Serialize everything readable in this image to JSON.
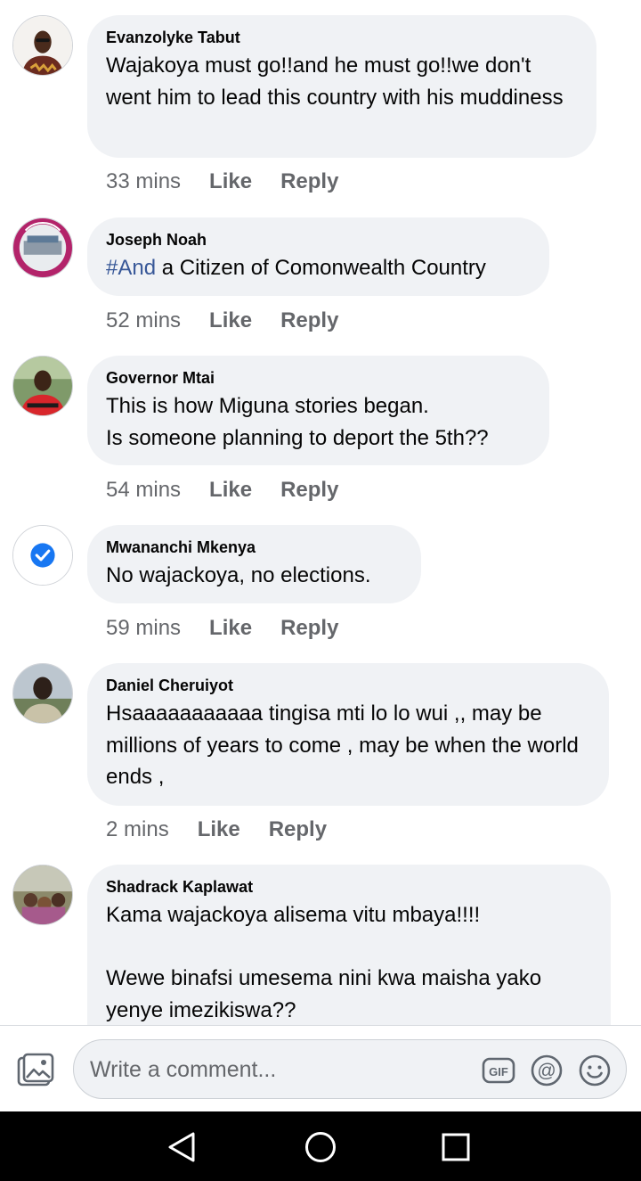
{
  "comments": [
    {
      "author": "Evanzolyke Tabut",
      "text": "Wajakoya must go!!and he must go!!we don't went him to lead this country with his muddiness",
      "time": "33 mins",
      "like": "Like",
      "reply": "Reply"
    },
    {
      "author": "Joseph Noah",
      "hashtag": "#And",
      "text": " a Citizen of Comonwealth Country",
      "time": "52 mins",
      "like": "Like",
      "reply": "Reply"
    },
    {
      "author": "Governor Mtai",
      "text": "This is how Miguna stories began.\nIs someone planning to deport the 5th??",
      "time": "54 mins",
      "like": "Like",
      "reply": "Reply"
    },
    {
      "author": "Mwananchi Mkenya",
      "text": "No wajackoya, no elections.",
      "time": "59 mins",
      "like": "Like",
      "reply": "Reply"
    },
    {
      "author": "Daniel Cheruiyot",
      "text": "Hsaaaaaaaaaaa tingisa mti lo lo wui ,, may be millions of years to come , may be when the world ends ,",
      "time": "2 mins",
      "like": "Like",
      "reply": "Reply"
    },
    {
      "author": "Shadrack Kaplawat",
      "text": "Kama wajackoya alisema vitu mbaya!!!!\n\nWewe binafsi umesema nini kwa maisha yako yenye imezikiswa??"
    }
  ],
  "composer": {
    "placeholder": "Write a comment...",
    "gif_label": "GIF",
    "icons": [
      "photo-icon",
      "gif-icon",
      "mention-icon",
      "emoji-icon"
    ]
  },
  "navigation": {
    "icons": [
      "back-icon",
      "home-icon",
      "recents-icon"
    ]
  },
  "colors": {
    "bubble": "#f0f2f5",
    "hashtag": "#385898",
    "meta": "#65676b",
    "verified": "#1877f2"
  }
}
